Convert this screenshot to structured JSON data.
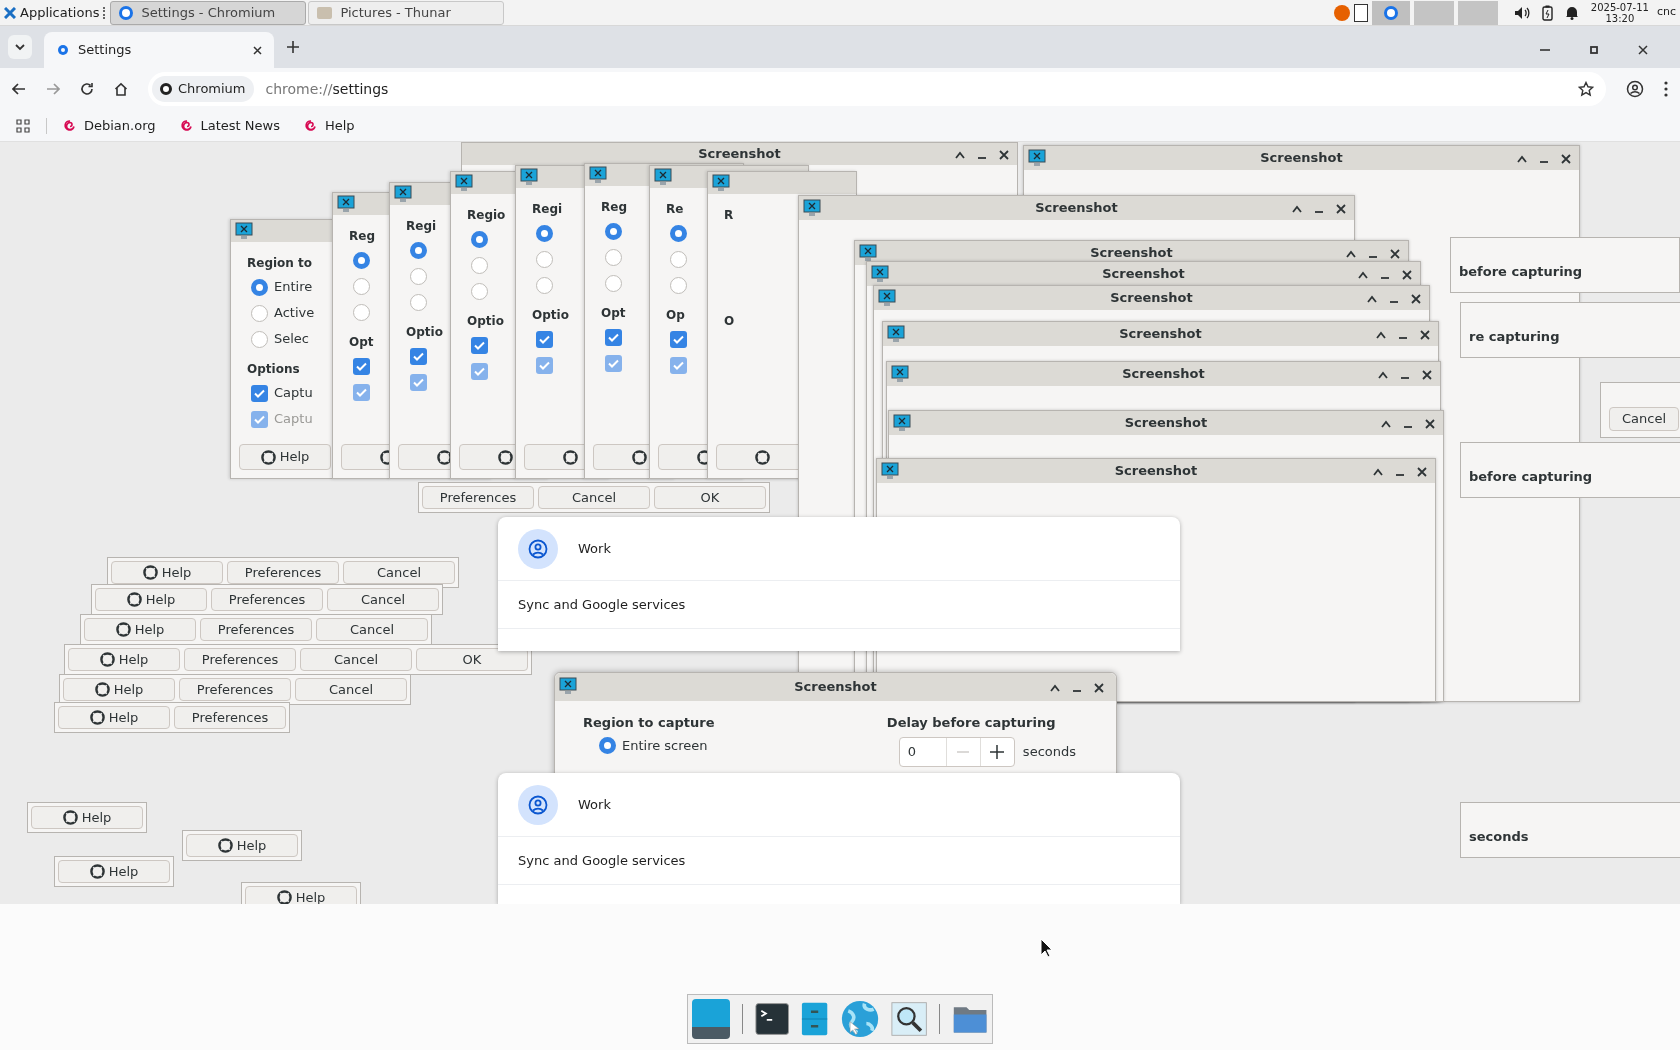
{
  "panel": {
    "menu": "Applications",
    "tasks": [
      {
        "title": "Settings - Chromium",
        "selected": true
      },
      {
        "title": "Pictures - Thunar",
        "selected": false
      }
    ],
    "date": "2025-07-11",
    "time": "13:20",
    "user": "cnc"
  },
  "browser": {
    "tab": "Settings",
    "site_chip": "Chromium",
    "url_scheme": "chrome://",
    "url_path": "settings",
    "bookmarks": [
      "Debian.org",
      "Latest News",
      "Help"
    ]
  },
  "back_button_rows": [
    {
      "buttons": [
        "Help",
        "Preferences",
        "Cancel"
      ]
    },
    {
      "buttons": [
        "Help",
        "Preferences",
        "Cancel"
      ]
    },
    {
      "buttons": [
        "Help",
        "Preferences",
        "Cancel"
      ]
    },
    {
      "buttons": [
        "Help",
        "Preferences",
        "Cancel",
        "OK"
      ]
    },
    {
      "buttons": [
        "Help",
        "Preferences",
        "Cancel"
      ]
    },
    {
      "buttons": [
        "Help",
        "Preferences"
      ]
    },
    {
      "buttons": [
        "Help"
      ]
    },
    {
      "buttons": [
        "Help"
      ]
    },
    {
      "buttons": [
        "Help"
      ]
    },
    {
      "buttons": [
        "Help"
      ]
    }
  ],
  "top_row_buttons": [
    "Preferences",
    "Cancel",
    "OK"
  ],
  "right_fragments": [
    {
      "text": "before capturing",
      "kind": "label"
    },
    {
      "text": "re capturing",
      "kind": "label"
    },
    {
      "text": "Cancel",
      "kind": "button"
    },
    {
      "text": "before capturing",
      "kind": "label"
    },
    {
      "text": "seconds",
      "kind": "label"
    }
  ],
  "screenshot_windows": [
    {
      "title": "Screenshot"
    },
    {
      "title": "Screenshot"
    },
    {
      "title": "Screenshot"
    },
    {
      "title": "Screenshot"
    },
    {
      "title": "Screenshot"
    },
    {
      "title": "Screenshot"
    },
    {
      "title": "Screenshot"
    },
    {
      "title": "Screenshot"
    },
    {
      "title": "Screenshot"
    },
    {
      "title": "Screenshot"
    }
  ],
  "options_windows": [
    {
      "heading": "Region to",
      "radios": [
        {
          "label": "Entire",
          "selected": true
        },
        {
          "label": "Active",
          "selected": false
        },
        {
          "label": "Selec",
          "selected": false
        }
      ],
      "options_heading": "Options",
      "checks": [
        {
          "label": "Captu",
          "checked": true,
          "disabled": false
        },
        {
          "label": "Captu",
          "checked": true,
          "disabled": true
        }
      ],
      "help_label": "Help"
    },
    {
      "heading": "Reg",
      "radios": [
        {
          "selected": true
        },
        {
          "selected": false
        },
        {
          "selected": false
        }
      ],
      "options_heading": "Opt",
      "checks": [
        {
          "checked": true,
          "disabled": false
        },
        {
          "checked": true,
          "disabled": true
        }
      ]
    },
    {
      "heading": "Regi",
      "radios": [
        {
          "selected": true
        },
        {
          "selected": false
        },
        {
          "selected": false
        }
      ],
      "options_heading": "Optio",
      "checks": [
        {
          "checked": true,
          "disabled": false
        },
        {
          "checked": true,
          "disabled": true
        }
      ]
    },
    {
      "heading": "Regio",
      "radios": [
        {
          "selected": true
        },
        {
          "selected": false
        },
        {
          "selected": false
        }
      ],
      "options_heading": "Optio",
      "checks": [
        {
          "checked": true,
          "disabled": false
        },
        {
          "checked": true,
          "disabled": true
        }
      ]
    },
    {
      "heading": "Regi",
      "radios": [
        {
          "selected": true
        },
        {
          "selected": false
        },
        {
          "selected": false
        }
      ],
      "options_heading": "Optio",
      "checks": [
        {
          "checked": true,
          "disabled": false
        },
        {
          "checked": true,
          "disabled": true
        }
      ]
    },
    {
      "heading": "Reg",
      "radios": [
        {
          "selected": true
        },
        {
          "selected": false
        },
        {
          "selected": false
        }
      ],
      "options_heading": "Opt",
      "checks": [
        {
          "checked": true,
          "disabled": false
        },
        {
          "checked": true,
          "disabled": true
        }
      ]
    },
    {
      "heading": "Re",
      "radios": [
        {
          "selected": true
        },
        {
          "selected": false
        },
        {
          "selected": false
        }
      ],
      "options_heading": "Op",
      "checks": [
        {
          "checked": true,
          "disabled": false
        },
        {
          "checked": true,
          "disabled": true
        }
      ]
    },
    {
      "heading": "R",
      "options_heading": "O"
    }
  ],
  "settings_cards": [
    {
      "profile": "Work",
      "item": "Sync and Google services"
    },
    {
      "profile": "Work",
      "item": "Sync and Google services"
    }
  ],
  "dialog": {
    "title": "Screenshot",
    "region_heading": "Region to capture",
    "radios": [
      {
        "label": "Entire screen",
        "selected": true
      }
    ],
    "delay_heading": "Delay before capturing",
    "delay_value": "0",
    "delay_unit": "seconds",
    "minus_disabled": true
  }
}
